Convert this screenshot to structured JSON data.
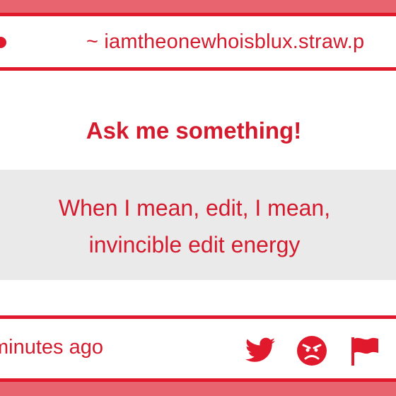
{
  "address_bar": {
    "url_text": "~ iamtheonewhoisblux.straw.p"
  },
  "card": {
    "title": "Ask me something!",
    "question_line1": "When I mean, edit, I mean,",
    "question_line2": "invincible edit energy"
  },
  "footer": {
    "timestamp": "minutes ago",
    "icons": [
      "twitter-icon",
      "angry-face-icon",
      "flag-icon"
    ]
  },
  "colors": {
    "accent": "#e0192c",
    "text": "#d41a2d",
    "band": "#e8646f",
    "question_bg": "#eaeaea"
  }
}
